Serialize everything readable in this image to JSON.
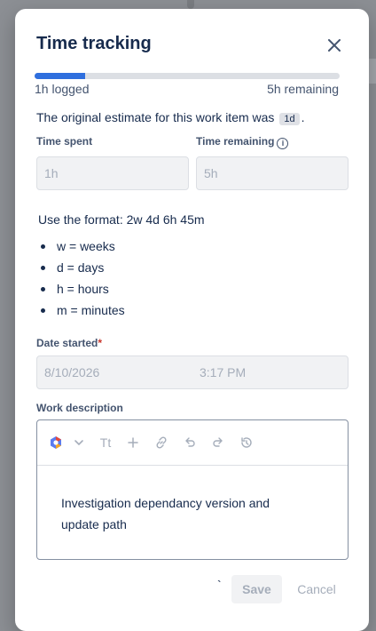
{
  "dialog": {
    "title": "Time tracking",
    "close_label": "Close"
  },
  "progress": {
    "logged_label": "1h logged",
    "remaining_label": "5h remaining",
    "fraction": 0.167,
    "color": "#2f6fde"
  },
  "estimate": {
    "text_before": "The original estimate for this work item was",
    "value": "1d",
    "text_after": "."
  },
  "time_spent": {
    "label": "Time spent",
    "placeholder": "1h"
  },
  "time_remaining": {
    "label": "Time remaining",
    "info_icon": "info-icon",
    "placeholder": "5h"
  },
  "format_help": {
    "line": "Use the format: 2w 4d 6h 45m",
    "items": [
      "w = weeks",
      "d = days",
      "h = hours",
      "m = minutes"
    ]
  },
  "date_started": {
    "label": "Date started",
    "required_mark": "*",
    "date_placeholder": "8/10/2026",
    "time_placeholder": "3:17 PM"
  },
  "work_description": {
    "label": "Work description",
    "toolbar": [
      "ai-icon",
      "chevron-down-icon",
      "text-style-icon",
      "plus-icon",
      "link-icon",
      "undo-icon",
      "redo-icon",
      "history-icon"
    ],
    "text_style_glyph": "Tt",
    "content": "Investigation dependancy version and update path"
  },
  "footer": {
    "stray_mark": "`",
    "save_label": "Save",
    "cancel_label": "Cancel"
  }
}
